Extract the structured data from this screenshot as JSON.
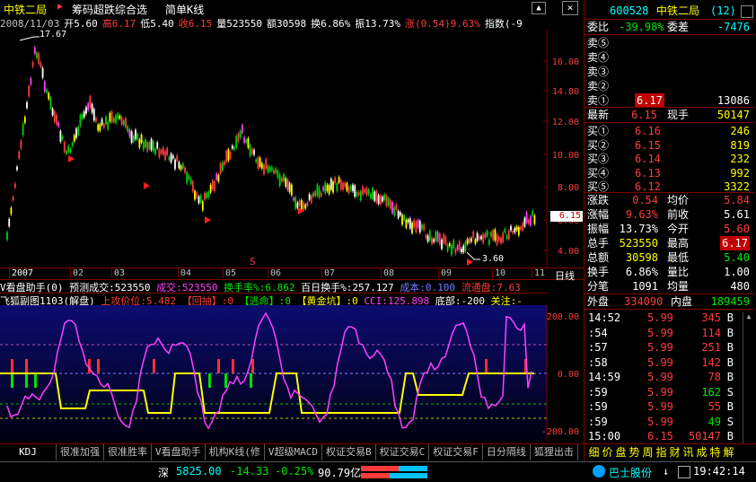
{
  "title_bar": {
    "stock_name": "中铁二局",
    "arrow": "▶",
    "formula_name": "筹码超跌综合选",
    "chart_mode": "简单K线"
  },
  "info_bar": {
    "date": "2008/11/03",
    "open": "开5.60",
    "high": "高6.17",
    "low": "低5.40",
    "close": "收6.15",
    "volume": "量523550",
    "amount": "额30598",
    "turnover": "换6.86%",
    "amplitude": "振13.73%",
    "change": "涨(0.54)9.63%",
    "index_label": "指数(-9"
  },
  "main_chart": {
    "high_marker": "17.67",
    "low_marker": "3.60",
    "y_ticks": [
      "16.00",
      "14.00",
      "12.00",
      "10.00",
      "8.00",
      "6.00",
      "4.00"
    ],
    "current_price_tag": "6.15",
    "s_marker": "S"
  },
  "date_axis": {
    "labels": [
      "2007",
      "02",
      "03",
      "04",
      "05",
      "06",
      "07",
      "08",
      "09",
      "10",
      "11"
    ],
    "right_label": "日线"
  },
  "indicator_line1": {
    "name": "V看盘助手(0)",
    "forecast": "预测成交:523550",
    "volume": "成交:523550",
    "turnover_rate": "换手率%:6.862",
    "hundred_day": "百日换手%:257.127",
    "cost": "成本:0.100",
    "flow": "流通盘:7.63"
  },
  "indicator_line2": {
    "name": "飞狐副图1103(解盘)",
    "up_limit": "上攻价位:5.482",
    "pullback": "【回抽】:0",
    "escape": "【逃命】:0",
    "gold_pit": "【黄金坑】:0",
    "cci": "CCI:125.898",
    "bottom": "底部:-200",
    "watch": "关注:-"
  },
  "sub_chart": {
    "y_ticks": [
      "200.00",
      "0.00",
      "-200.00"
    ]
  },
  "bottom_tabs": [
    "KDJ",
    "很准加强",
    "很准胜率",
    "V看盘助手",
    "机构K线(修",
    "V超级MACD",
    "权证交易B",
    "权证交易C",
    "权证交易F",
    "日分隔线",
    "狐狸出击"
  ],
  "nav_tabs": [
    "细",
    "价",
    "盘",
    "势",
    "周",
    "指",
    "财",
    "讯",
    "成",
    "特",
    "解"
  ],
  "status_bar": {
    "market": "深",
    "index_value": "5825.00",
    "change": "-14.33",
    "pct": "-0.25%",
    "amount": "90.79亿",
    "ticker_name": "巴士股份",
    "ticker_arrow": "↓",
    "time": "19:42:14"
  },
  "quote_panel": {
    "code": "600528",
    "name": "中铁二局",
    "suffix": "(12)",
    "weibi_label": "委比",
    "weibi_value": "-39.98%",
    "weicha_label": "委差",
    "weicha_value": "-7476",
    "sells": [
      {
        "label": "卖⑤",
        "price": "",
        "vol": ""
      },
      {
        "label": "卖④",
        "price": "",
        "vol": ""
      },
      {
        "label": "卖③",
        "price": "",
        "vol": ""
      },
      {
        "label": "卖②",
        "price": "",
        "vol": ""
      },
      {
        "label": "卖①",
        "price": "6.17",
        "vol": "13086"
      }
    ],
    "latest_label": "最新",
    "latest_value": "6.15",
    "current_hand_label": "现手",
    "current_hand_value": "50147",
    "buys": [
      {
        "label": "买①",
        "price": "6.16",
        "vol": "246"
      },
      {
        "label": "买②",
        "price": "6.15",
        "vol": "819"
      },
      {
        "label": "买③",
        "price": "6.14",
        "vol": "232"
      },
      {
        "label": "买④",
        "price": "6.13",
        "vol": "992"
      },
      {
        "label": "买⑤",
        "price": "6.12",
        "vol": "3322"
      }
    ],
    "stats": [
      {
        "l1": "涨跌",
        "v1": "0.54",
        "l2": "均价",
        "v2": "5.84"
      },
      {
        "l1": "涨幅",
        "v1": "9.63%",
        "l2": "前收",
        "v2": "5.61"
      },
      {
        "l1": "振幅",
        "v1": "13.73%",
        "l2": "今开",
        "v2": "5.60"
      },
      {
        "l1": "总手",
        "v1": "523550",
        "l2": "最高",
        "v2": "6.17"
      },
      {
        "l1": "总额",
        "v1": "30598",
        "l2": "最低",
        "v2": "5.40"
      },
      {
        "l1": "换手",
        "v1": "6.86%",
        "l2": "量比",
        "v2": "1.00"
      },
      {
        "l1": "分笔",
        "v1": "1091",
        "l2": "均量",
        "v2": "480"
      }
    ],
    "outer_label": "外盘",
    "outer_value": "334090",
    "inner_label": "内盘",
    "inner_value": "189459",
    "ticks": [
      {
        "time": "14:52",
        "price": "5.99",
        "vol": "345",
        "dir": "B"
      },
      {
        "time": ":54",
        "price": "5.99",
        "vol": "114",
        "dir": "B"
      },
      {
        "time": ":57",
        "price": "5.99",
        "vol": "251",
        "dir": "B"
      },
      {
        "time": ":58",
        "price": "5.99",
        "vol": "142",
        "dir": "B"
      },
      {
        "time": "14:59",
        "price": "5.99",
        "vol": "78",
        "dir": "B"
      },
      {
        "time": ":59",
        "price": "5.99",
        "vol": "162",
        "dir": "S"
      },
      {
        "time": ":59",
        "price": "5.99",
        "vol": "55",
        "dir": "B"
      },
      {
        "time": ":59",
        "price": "5.99",
        "vol": "49",
        "dir": "S"
      },
      {
        "time": "15:00",
        "price": "6.15",
        "vol": "50147",
        "dir": "B"
      }
    ]
  },
  "colors": {
    "up": "#ff3c3c",
    "down": "#00e600",
    "accent": "#ffff00",
    "cyan": "#00ffff",
    "magenta": "#ff40ff",
    "sub_bg_top": "#0a0a60",
    "sub_bg_bottom": "#000010"
  }
}
